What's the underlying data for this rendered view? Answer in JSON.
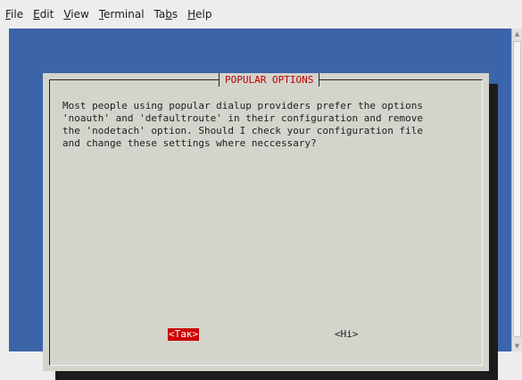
{
  "menubar": {
    "items": [
      {
        "mnemonic": "F",
        "rest": "ile"
      },
      {
        "mnemonic": "E",
        "rest": "dit"
      },
      {
        "mnemonic": "V",
        "rest": "iew"
      },
      {
        "mnemonic": "T",
        "rest": "erminal"
      },
      {
        "prefix": "Ta",
        "mnemonic": "b",
        "rest": "s"
      },
      {
        "mnemonic": "H",
        "rest": "elp"
      }
    ]
  },
  "dialog": {
    "title": "POPULAR OPTIONS",
    "message": "Most people using popular dialup providers prefer the options\n'noauth' and 'defaultroute' in their configuration and remove\nthe 'nodetach' option. Should I check your configuration file\nand change these settings where neccessary?",
    "yes_label": "<Так>",
    "no_label": "<Hi>"
  },
  "colors": {
    "terminal_bg": "#3c64a8",
    "dialog_bg": "#d4d4cc",
    "title_color": "#b80000",
    "selected_button_bg": "#cc0000"
  }
}
